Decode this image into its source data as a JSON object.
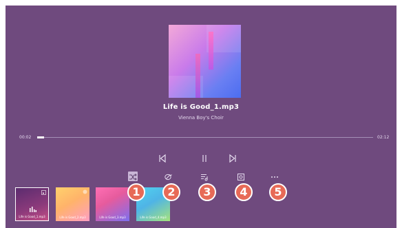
{
  "player": {
    "title": "Life is Good_1.mp3",
    "artist": "Vienna Boy's Choir",
    "time_elapsed": "00:02",
    "time_total": "02:12",
    "progress_fraction": 0.015
  },
  "controls": {
    "previous_icon": "skip-previous-icon",
    "pause_icon": "pause-icon",
    "next_icon": "skip-next-icon"
  },
  "options": [
    {
      "icon": "shuffle-icon",
      "callout": "1"
    },
    {
      "icon": "repeat-icon",
      "callout": "2"
    },
    {
      "icon": "playlist-icon",
      "callout": "3"
    },
    {
      "icon": "screen-icon",
      "callout": "4"
    },
    {
      "icon": "more-icon",
      "callout": "5"
    }
  ],
  "playlist": [
    {
      "label": "Life is Good_1.mp3",
      "selected": true
    },
    {
      "label": "Life is Good_2.mp3",
      "selected": false
    },
    {
      "label": "Life is Good_3.mp3",
      "selected": false
    },
    {
      "label": "Life is Good_4.mp3",
      "selected": false
    }
  ],
  "colors": {
    "background": "#6f4a7e",
    "callout": "#e76a57",
    "text": "#ffffff"
  }
}
